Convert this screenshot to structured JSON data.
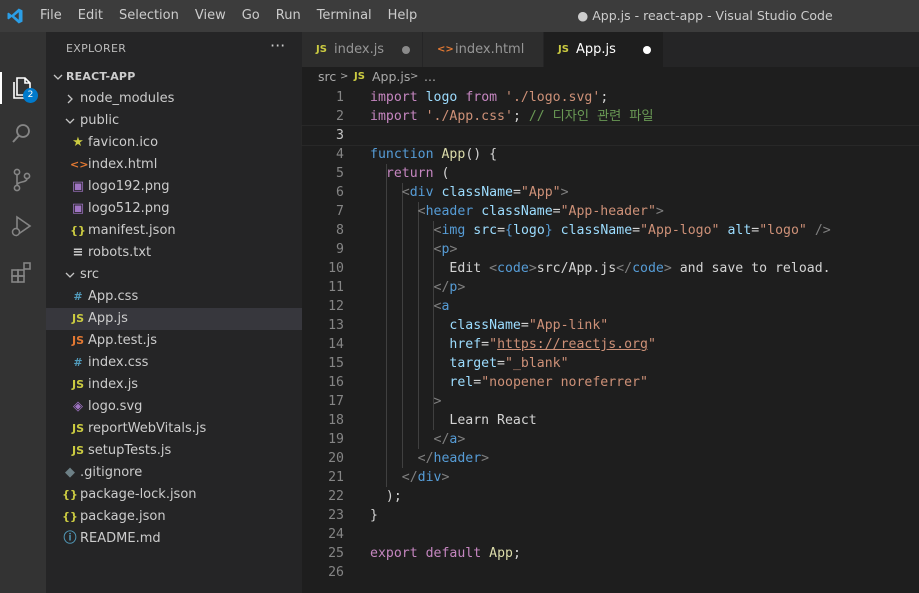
{
  "window": {
    "title": "● App.js - react-app - Visual Studio Code"
  },
  "menu": [
    "File",
    "Edit",
    "Selection",
    "View",
    "Go",
    "Run",
    "Terminal",
    "Help"
  ],
  "activity_bar": {
    "items": [
      {
        "name": "explorer",
        "icon": "files-icon"
      },
      {
        "name": "search",
        "icon": "search-icon"
      },
      {
        "name": "source-control",
        "icon": "source-control-icon"
      },
      {
        "name": "run-debug",
        "icon": "debug-icon"
      },
      {
        "name": "extensions",
        "icon": "extensions-icon"
      }
    ],
    "explorer_badge": "2"
  },
  "explorer": {
    "title": "EXPLORER",
    "more": "···",
    "root": "REACT-APP",
    "items": [
      {
        "label": "node_modules",
        "type": "folder",
        "expanded": false,
        "depth": 1
      },
      {
        "label": "public",
        "type": "folder",
        "expanded": true,
        "depth": 1
      },
      {
        "label": "favicon.ico",
        "type": "file",
        "icon": "star-icon",
        "depth": 2
      },
      {
        "label": "index.html",
        "type": "file",
        "icon": "html-icon",
        "depth": 2
      },
      {
        "label": "logo192.png",
        "type": "file",
        "icon": "image-icon",
        "depth": 2
      },
      {
        "label": "logo512.png",
        "type": "file",
        "icon": "image-icon",
        "depth": 2
      },
      {
        "label": "manifest.json",
        "type": "file",
        "icon": "json-icon",
        "depth": 2
      },
      {
        "label": "robots.txt",
        "type": "file",
        "icon": "text-icon",
        "depth": 2
      },
      {
        "label": "src",
        "type": "folder",
        "expanded": true,
        "depth": 1
      },
      {
        "label": "App.css",
        "type": "file",
        "icon": "css-icon",
        "depth": 2
      },
      {
        "label": "App.js",
        "type": "file",
        "icon": "js-icon",
        "depth": 2,
        "selected": true
      },
      {
        "label": "App.test.js",
        "type": "file",
        "icon": "js-test-icon",
        "depth": 2
      },
      {
        "label": "index.css",
        "type": "file",
        "icon": "css-icon",
        "depth": 2
      },
      {
        "label": "index.js",
        "type": "file",
        "icon": "js-icon",
        "depth": 2
      },
      {
        "label": "logo.svg",
        "type": "file",
        "icon": "svg-icon",
        "depth": 2
      },
      {
        "label": "reportWebVitals.js",
        "type": "file",
        "icon": "js-icon",
        "depth": 2
      },
      {
        "label": "setupTests.js",
        "type": "file",
        "icon": "js-icon",
        "depth": 2
      },
      {
        "label": ".gitignore",
        "type": "file",
        "icon": "git-icon",
        "depth": 1
      },
      {
        "label": "package-lock.json",
        "type": "file",
        "icon": "json-icon",
        "depth": 1
      },
      {
        "label": "package.json",
        "type": "file",
        "icon": "json-icon",
        "depth": 1
      },
      {
        "label": "README.md",
        "type": "file",
        "icon": "info-icon",
        "depth": 1
      }
    ]
  },
  "tabs": [
    {
      "label": "index.js",
      "icon": "JS",
      "modified": true,
      "active": false
    },
    {
      "label": "index.html",
      "icon": "<>",
      "modified": false,
      "active": false
    },
    {
      "label": "App.js",
      "icon": "JS",
      "modified": true,
      "active": true
    }
  ],
  "breadcrumbs": {
    "folder": "src",
    "sep": ">",
    "file_icon": "JS",
    "file": "App.js",
    "more": "..."
  },
  "code": {
    "current_line": 3,
    "lines": [
      [
        [
          "kw",
          "import"
        ],
        [
          "t",
          " "
        ],
        [
          "var",
          "logo"
        ],
        [
          "t",
          " "
        ],
        [
          "kw",
          "from"
        ],
        [
          "t",
          " "
        ],
        [
          "str",
          "'./logo.svg'"
        ],
        [
          "t",
          ";"
        ]
      ],
      [
        [
          "kw",
          "import"
        ],
        [
          "t",
          " "
        ],
        [
          "str",
          "'./App.css'"
        ],
        [
          "t",
          "; "
        ],
        [
          "cmt",
          "// 디자인 관련 파일"
        ]
      ],
      [],
      [
        [
          "kw2",
          "function"
        ],
        [
          "t",
          " "
        ],
        [
          "fn",
          "App"
        ],
        [
          "t",
          "() {"
        ]
      ],
      [
        [
          "t",
          "  "
        ],
        [
          "kw",
          "return"
        ],
        [
          "t",
          " ("
        ]
      ],
      [
        [
          "t",
          "    "
        ],
        [
          "tagp",
          "<"
        ],
        [
          "tag",
          "div"
        ],
        [
          "t",
          " "
        ],
        [
          "attr",
          "className"
        ],
        [
          "t",
          "="
        ],
        [
          "str",
          "\"App\""
        ],
        [
          "tagp",
          ">"
        ]
      ],
      [
        [
          "t",
          "      "
        ],
        [
          "tagp",
          "<"
        ],
        [
          "tag",
          "header"
        ],
        [
          "t",
          " "
        ],
        [
          "attr",
          "className"
        ],
        [
          "t",
          "="
        ],
        [
          "str",
          "\"App-header\""
        ],
        [
          "tagp",
          ">"
        ]
      ],
      [
        [
          "t",
          "        "
        ],
        [
          "tagp",
          "<"
        ],
        [
          "tag",
          "img"
        ],
        [
          "t",
          " "
        ],
        [
          "attr",
          "src"
        ],
        [
          "t",
          "="
        ],
        [
          "kw2",
          "{"
        ],
        [
          "var",
          "logo"
        ],
        [
          "kw2",
          "}"
        ],
        [
          "t",
          " "
        ],
        [
          "attr",
          "className"
        ],
        [
          "t",
          "="
        ],
        [
          "str",
          "\"App-logo\""
        ],
        [
          "t",
          " "
        ],
        [
          "attr",
          "alt"
        ],
        [
          "t",
          "="
        ],
        [
          "str",
          "\"logo\""
        ],
        [
          "t",
          " "
        ],
        [
          "tagp",
          "/>"
        ]
      ],
      [
        [
          "t",
          "        "
        ],
        [
          "tagp",
          "<"
        ],
        [
          "tag",
          "p"
        ],
        [
          "tagp",
          ">"
        ]
      ],
      [
        [
          "t",
          "          Edit "
        ],
        [
          "tagp",
          "<"
        ],
        [
          "tag",
          "code"
        ],
        [
          "tagp",
          ">"
        ],
        [
          "t",
          "src/App.js"
        ],
        [
          "tagp",
          "</"
        ],
        [
          "tag",
          "code"
        ],
        [
          "tagp",
          ">"
        ],
        [
          "t",
          " and save to reload."
        ]
      ],
      [
        [
          "t",
          "        "
        ],
        [
          "tagp",
          "</"
        ],
        [
          "tag",
          "p"
        ],
        [
          "tagp",
          ">"
        ]
      ],
      [
        [
          "t",
          "        "
        ],
        [
          "tagp",
          "<"
        ],
        [
          "tag",
          "a"
        ]
      ],
      [
        [
          "t",
          "          "
        ],
        [
          "attr",
          "className"
        ],
        [
          "t",
          "="
        ],
        [
          "str",
          "\"App-link\""
        ]
      ],
      [
        [
          "t",
          "          "
        ],
        [
          "attr",
          "href"
        ],
        [
          "t",
          "="
        ],
        [
          "str",
          "\""
        ],
        [
          "url",
          "https://reactjs.org"
        ],
        [
          "str",
          "\""
        ]
      ],
      [
        [
          "t",
          "          "
        ],
        [
          "attr",
          "target"
        ],
        [
          "t",
          "="
        ],
        [
          "str",
          "\"_blank\""
        ]
      ],
      [
        [
          "t",
          "          "
        ],
        [
          "attr",
          "rel"
        ],
        [
          "t",
          "="
        ],
        [
          "str",
          "\"noopener noreferrer\""
        ]
      ],
      [
        [
          "t",
          "        "
        ],
        [
          "tagp",
          ">"
        ]
      ],
      [
        [
          "t",
          "          Learn React"
        ]
      ],
      [
        [
          "t",
          "        "
        ],
        [
          "tagp",
          "</"
        ],
        [
          "tag",
          "a"
        ],
        [
          "tagp",
          ">"
        ]
      ],
      [
        [
          "t",
          "      "
        ],
        [
          "tagp",
          "</"
        ],
        [
          "tag",
          "header"
        ],
        [
          "tagp",
          ">"
        ]
      ],
      [
        [
          "t",
          "    "
        ],
        [
          "tagp",
          "</"
        ],
        [
          "tag",
          "div"
        ],
        [
          "tagp",
          ">"
        ]
      ],
      [
        [
          "t",
          "  );"
        ]
      ],
      [
        [
          "t",
          "}"
        ]
      ],
      [],
      [
        [
          "kw",
          "export"
        ],
        [
          "t",
          " "
        ],
        [
          "kw",
          "default"
        ],
        [
          "t",
          " "
        ],
        [
          "fn",
          "App"
        ],
        [
          "t",
          ";"
        ]
      ],
      []
    ]
  },
  "colors": {
    "kw": "#c586c0",
    "kw2": "#569cd6",
    "var": "#9cdcfe",
    "str": "#ce9178",
    "cmt": "#6a9955",
    "fn": "#dcdcaa",
    "tag": "#569cd6",
    "tagp": "#808080",
    "attr": "#9cdcfe",
    "t": "#d4d4d4",
    "url": "#ce9178",
    "js": "#cbcb41",
    "html": "#e37933",
    "css": "#519aba",
    "json": "#cbcb41",
    "image": "#a074c4",
    "svg": "#a074c4",
    "star": "#cbcb41",
    "info": "#519aba",
    "git": "#41535b",
    "text": "#cccccc",
    "test": "#e37933"
  }
}
